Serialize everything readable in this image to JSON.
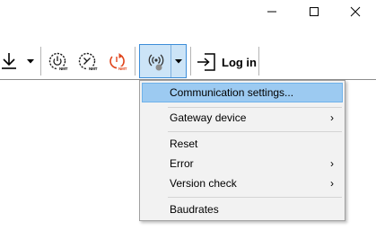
{
  "window": {
    "minimize_icon": "minimize-icon",
    "maximize_icon": "maximize-icon",
    "close_icon": "close-icon"
  },
  "toolbar": {
    "download_icon": "download-icon",
    "download_dropdown_icon": "chevron-down-icon",
    "nmt_buttons": [
      {
        "icon": "nmt-start-icon",
        "badge": "NMT",
        "color": "#1a1a1a"
      },
      {
        "icon": "nmt-stop-icon",
        "badge": "NMT",
        "color": "#1a1a1a"
      },
      {
        "icon": "nmt-reset-icon",
        "badge": "NMT",
        "color": "#e0441b"
      }
    ],
    "communication_icon": "radio-signal-icon",
    "communication_dropdown_icon": "chevron-down-icon",
    "login_icon": "login-icon",
    "login_label": "Log in"
  },
  "menu": {
    "items": [
      {
        "label": "Communication settings...",
        "highlighted": true,
        "submenu": false
      },
      {
        "label": "Gateway device",
        "highlighted": false,
        "submenu": true
      },
      {
        "label": "Reset",
        "highlighted": false,
        "submenu": false
      },
      {
        "label": "Error",
        "highlighted": false,
        "submenu": true
      },
      {
        "label": "Version check",
        "highlighted": false,
        "submenu": true
      },
      {
        "label": "Baudrates",
        "highlighted": false,
        "submenu": false
      }
    ],
    "submenu_arrow": "›"
  },
  "colors": {
    "highlight": "#9ccaf1",
    "pressed_button": "#cce4f7",
    "reset_accent": "#e0441b"
  }
}
